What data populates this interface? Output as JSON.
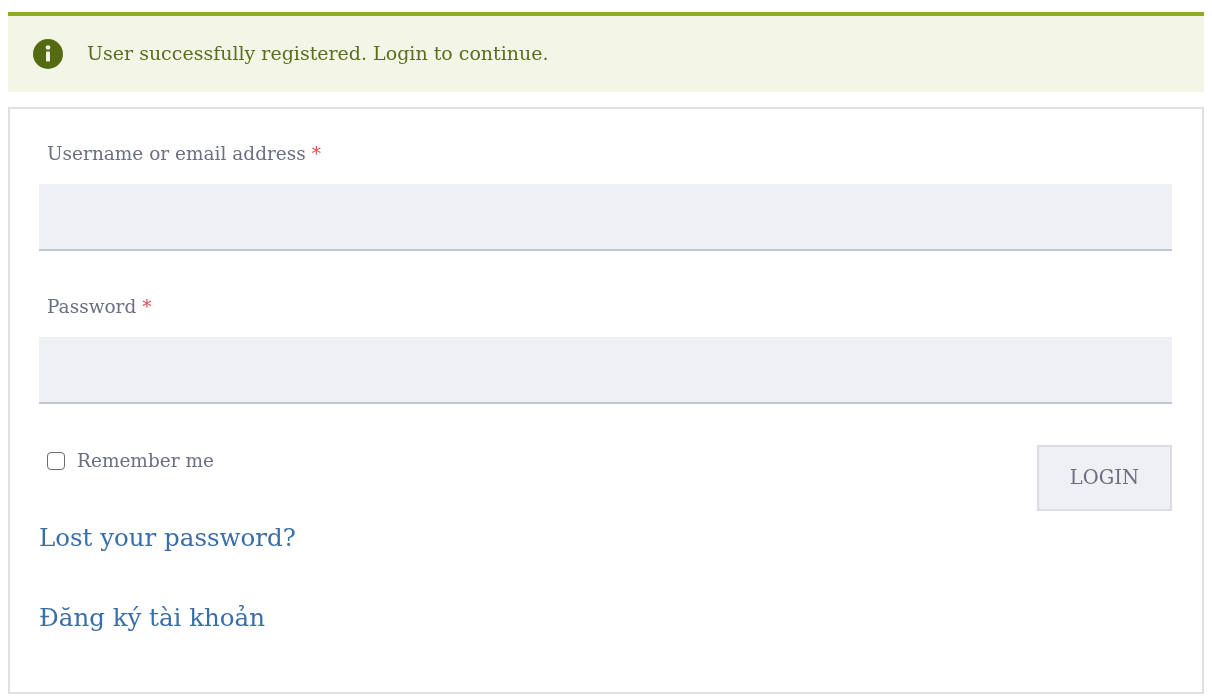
{
  "notice": {
    "text": "User successfully registered. Login to continue."
  },
  "form": {
    "fields": [
      {
        "label": "Username or email address",
        "required_mark": "*"
      },
      {
        "label": "Password",
        "required_mark": "*"
      }
    ],
    "remember": {
      "label": "Remember me",
      "checked": false
    },
    "login_button": "LOGIN",
    "links": [
      "Lost your password?",
      "Đăng ký tài khoản"
    ]
  }
}
